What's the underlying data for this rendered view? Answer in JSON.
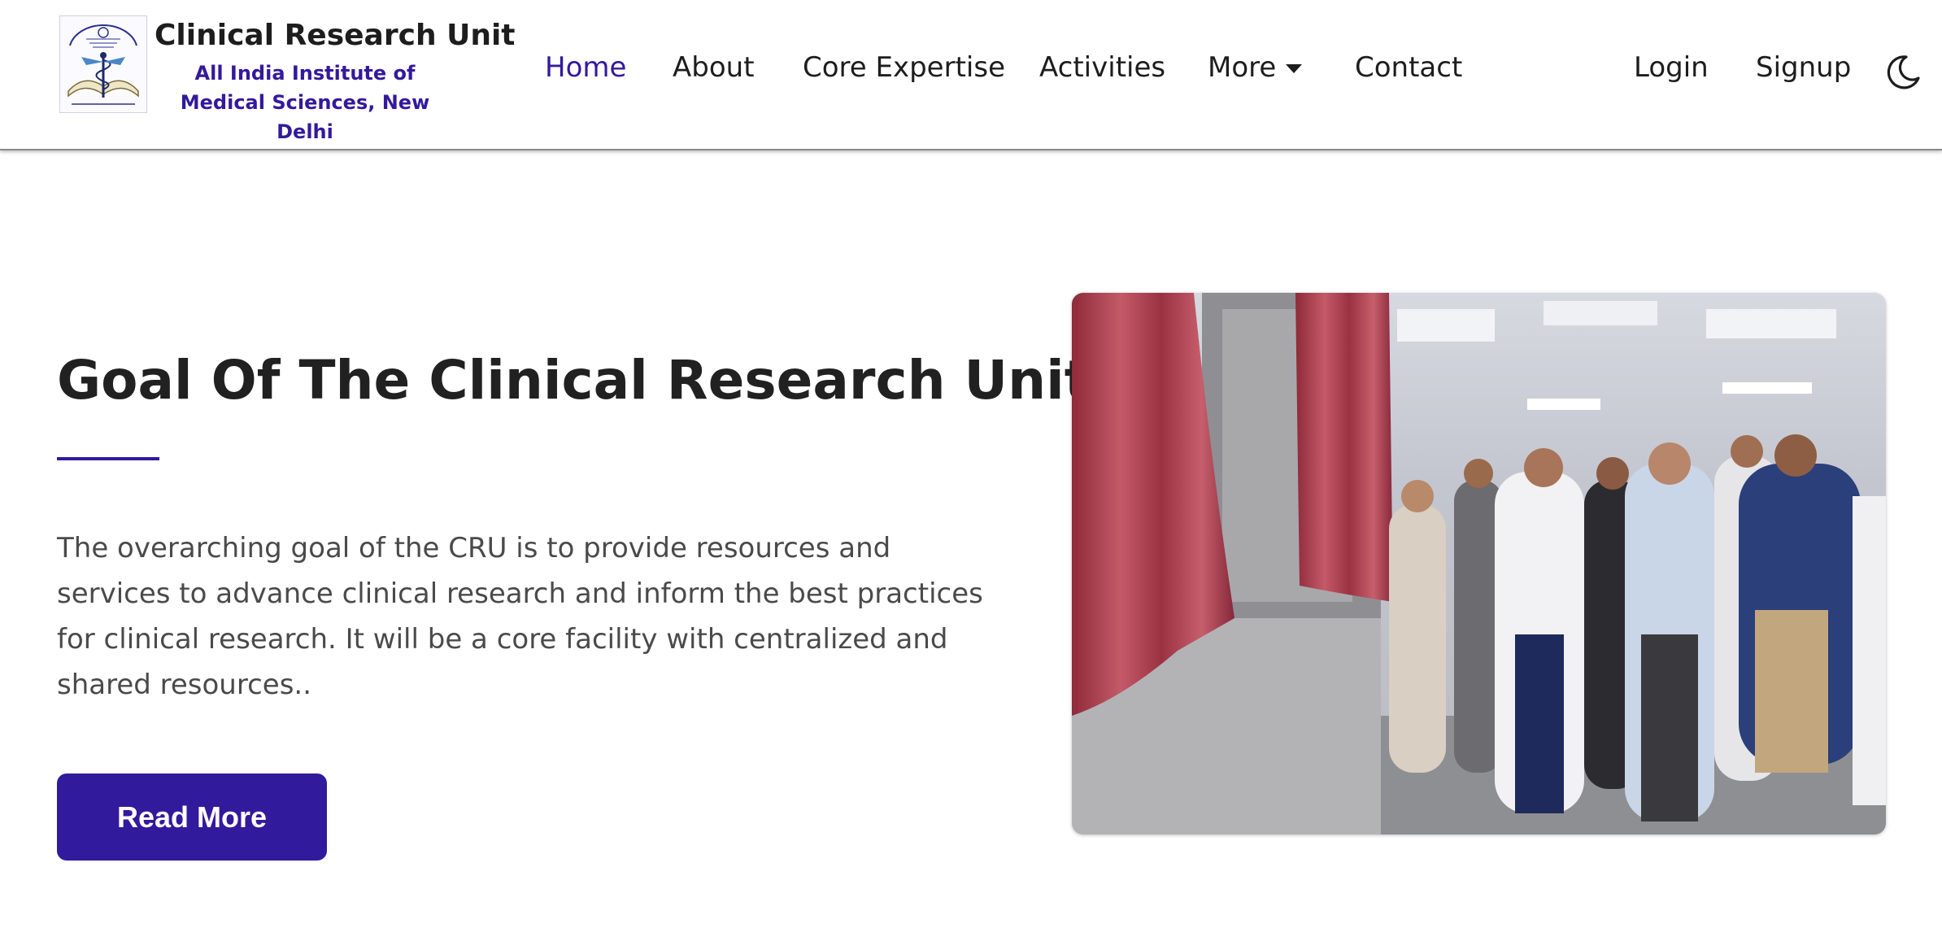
{
  "brand": {
    "title": "Clinical Research Unit",
    "subtitle": "All India Institute of Medical Sciences, New Delhi",
    "logo_icon": "cru-aiims-seal-icon"
  },
  "nav": {
    "items": [
      {
        "label": "Home",
        "active": true
      },
      {
        "label": "About"
      },
      {
        "label": "Core Expertise"
      },
      {
        "label": "Activities"
      },
      {
        "label": "More",
        "has_dropdown": true
      },
      {
        "label": "Contact"
      }
    ],
    "login": "Login",
    "signup": "Signup",
    "theme_toggle_icon": "moon-icon"
  },
  "hero": {
    "title": "Goal Of The Clinical Research Unit",
    "text": "The overarching goal of the CRU is to provide resources and services to advance clinical research and inform the best practices for clinical research. It will be a core facility with centralized and shared resources..",
    "button": "Read More",
    "image_icon": "inauguration-photo"
  },
  "colors": {
    "accent": "#321a9c",
    "text_dark": "#212121",
    "text_body": "#4a4a4a",
    "curtain": "#a83c4a"
  }
}
